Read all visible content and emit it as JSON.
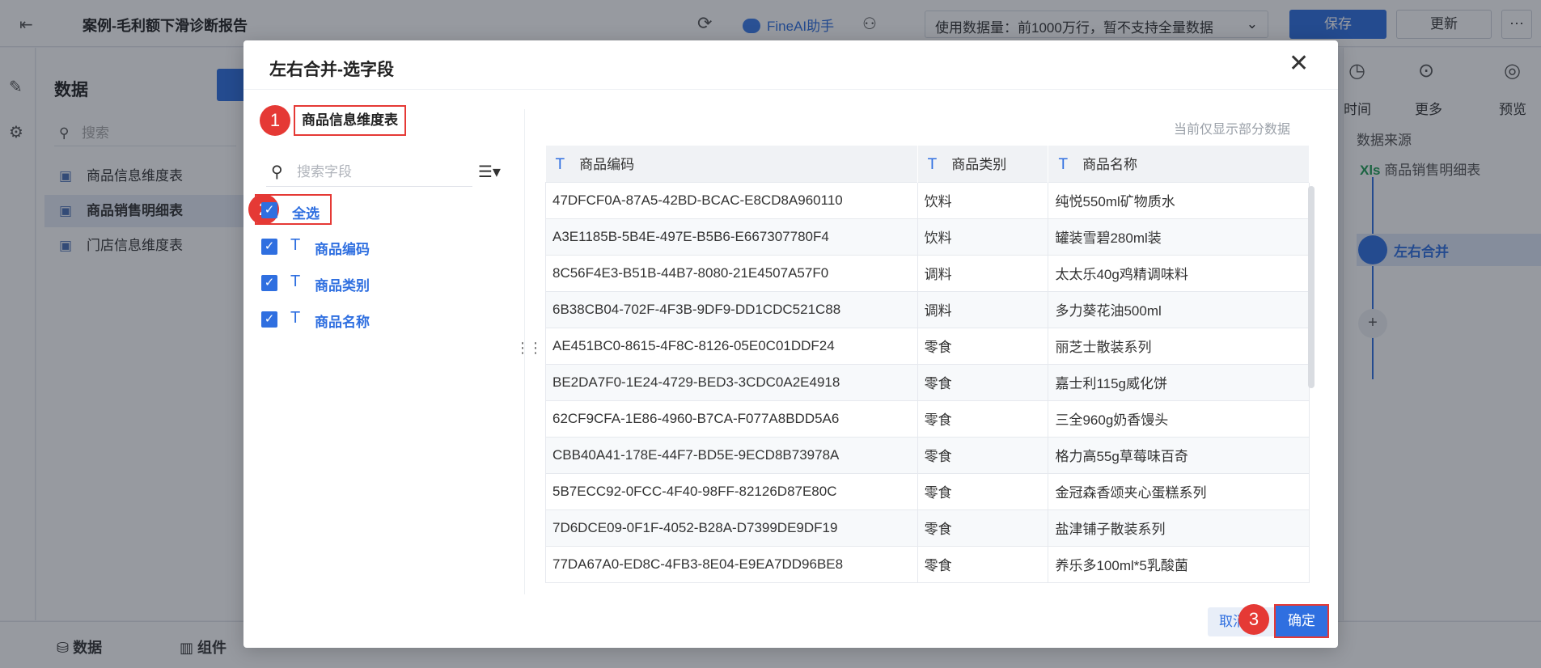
{
  "topbar": {
    "title": "案例-毛利额下滑诊断报告",
    "ai_label": "FineAI助手",
    "usage_text": "使用数据量：前1000万行，暂不支持全量数据",
    "save_label": "保存",
    "update_label": "更新",
    "more_label": "···"
  },
  "data_panel": {
    "title": "数据",
    "search_placeholder": "搜索",
    "items": [
      {
        "label": "商品信息维度表"
      },
      {
        "label": "商品销售明细表"
      },
      {
        "label": "门店信息维度表"
      }
    ]
  },
  "right_panel": {
    "tools": [
      "时间",
      "更多",
      "预览"
    ],
    "source_title": "数据来源",
    "source_item": "商品销售明细表",
    "merge_step": "左右合并"
  },
  "bottom_tabs": [
    "数据",
    "组件"
  ],
  "dialog": {
    "title": "左右合并-选字段",
    "table_name": "商品信息维度表",
    "search_placeholder": "搜索字段",
    "select_all": "全选",
    "fields": [
      "商品编码",
      "商品类别",
      "商品名称"
    ],
    "note": "当前仅显示部分数据",
    "columns": [
      "商品编码",
      "商品类别",
      "商品名称"
    ],
    "rows": [
      [
        "47DFCF0A-87A5-42BD-BCAC-E8CD8A960110",
        "饮料",
        "纯悦550ml矿物质水"
      ],
      [
        "A3E1185B-5B4E-497E-B5B6-E667307780F4",
        "饮料",
        "罐装雪碧280ml装"
      ],
      [
        "8C56F4E3-B51B-44B7-8080-21E4507A57F0",
        "调料",
        "太太乐40g鸡精调味料"
      ],
      [
        "6B38CB04-702F-4F3B-9DF9-DD1CDC521C88",
        "调料",
        "多力葵花油500ml"
      ],
      [
        "AE451BC0-8615-4F8C-8126-05E0C01DDF24",
        "零食",
        "丽芝士散装系列"
      ],
      [
        "BE2DA7F0-1E24-4729-BED3-3CDC0A2E4918",
        "零食",
        "嘉士利115g威化饼"
      ],
      [
        "62CF9CFA-1E86-4960-B7CA-F077A8BDD5A6",
        "零食",
        "三全960g奶香馒头"
      ],
      [
        "CBB40A41-178E-44F7-BD5E-9ECD8B73978A",
        "零食",
        "格力高55g草莓味百奇"
      ],
      [
        "5B7ECC92-0FCC-4F40-98FF-82126D87E80C",
        "零食",
        "金冠森香颂夹心蛋糕系列"
      ],
      [
        "7D6DCE09-0F1F-4052-B28A-D7399DE9DF19",
        "零食",
        "盐津铺子散装系列"
      ],
      [
        "77DA67A0-ED8C-4FB3-8E04-E9EA7DD96BE8",
        "零食",
        "养乐多100ml*5乳酸菌"
      ]
    ],
    "cancel_label": "取消",
    "confirm_label": "确定",
    "step_badges": [
      "1",
      "2",
      "3"
    ]
  }
}
